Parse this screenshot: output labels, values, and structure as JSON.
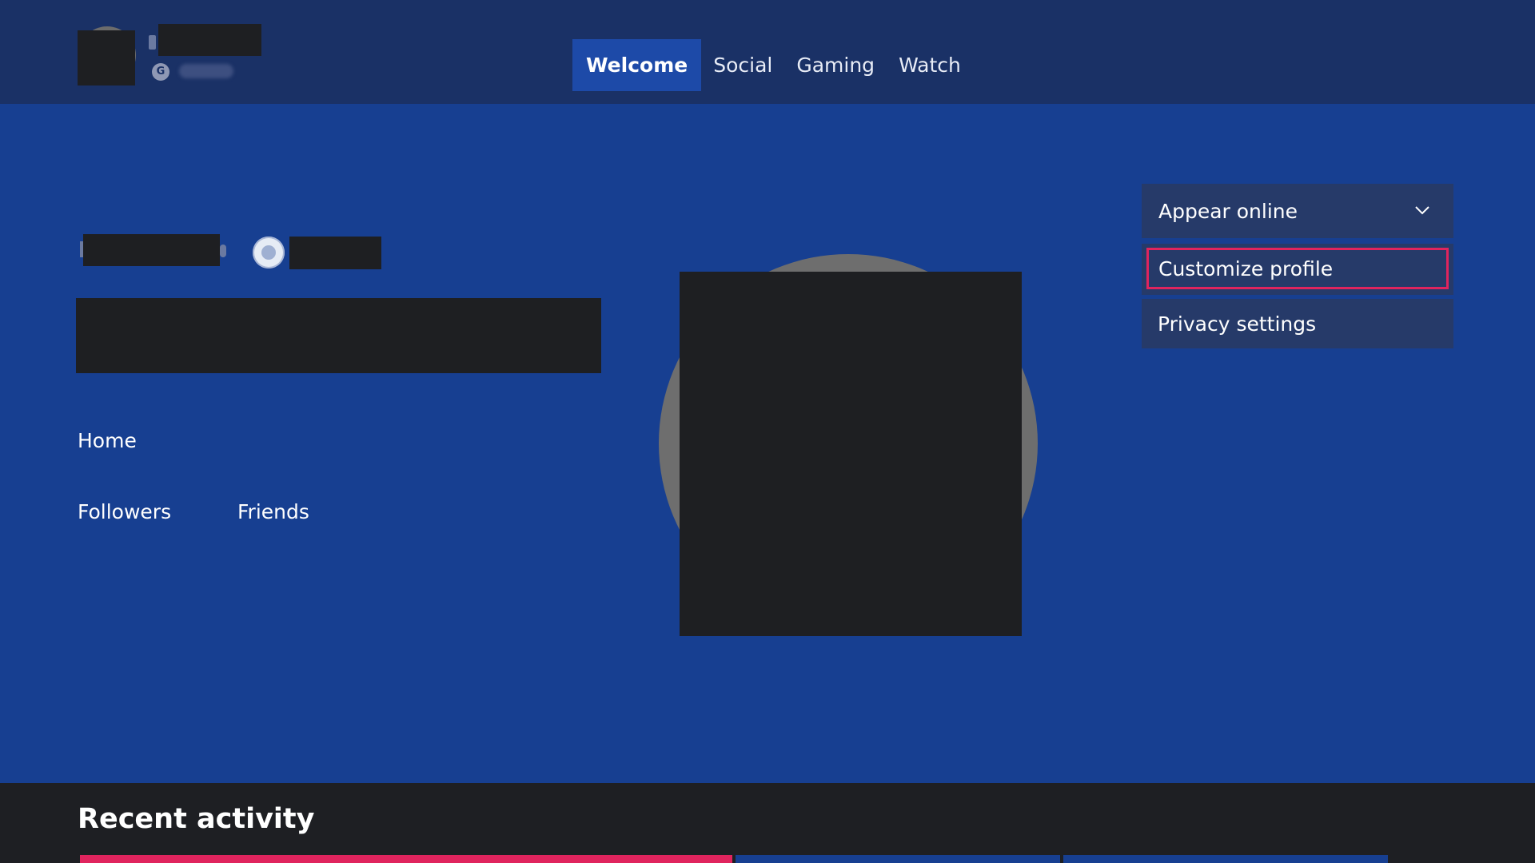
{
  "header": {
    "gamerscore_badge": "G",
    "tabs": [
      {
        "label": "Welcome",
        "active": true
      },
      {
        "label": "Social",
        "active": false
      },
      {
        "label": "Gaming",
        "active": false
      },
      {
        "label": "Watch",
        "active": false
      }
    ]
  },
  "profile_menu": {
    "status_dropdown": {
      "selected": "Appear online",
      "icon": "chevron-down-icon"
    },
    "items": [
      {
        "label": "Customize profile",
        "focused": true
      },
      {
        "label": "Privacy settings",
        "focused": false
      }
    ]
  },
  "profile": {
    "links": {
      "home": "Home",
      "followers": "Followers",
      "friends": "Friends"
    }
  },
  "recent_activity": {
    "title": "Recent activity"
  },
  "colors": {
    "page_bg": "#173f91",
    "header_bg": "#1a3166",
    "active_tab": "#1d4aa8",
    "menu_bg": "#263a69",
    "focus_border": "#e0245e",
    "activity_bg": "#1e1f23",
    "redaction": "#1e1f22"
  }
}
